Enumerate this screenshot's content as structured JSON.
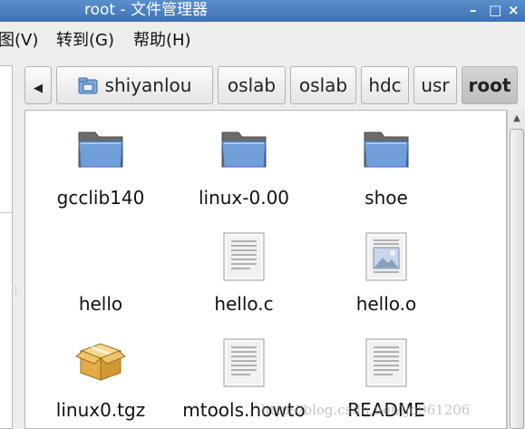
{
  "window": {
    "title": "root - 文件管理器",
    "controls": {
      "minimize": "–",
      "maximize": "□",
      "close": "×"
    }
  },
  "menubar": {
    "items": [
      {
        "label": "图(V)"
      },
      {
        "label": "转到(G)"
      },
      {
        "label": "帮助(H)"
      }
    ]
  },
  "pathbar": {
    "back_arrow": "◀",
    "crumbs": [
      {
        "label": "shiyanlou",
        "icon": "home-folder-icon"
      },
      {
        "label": "oslab"
      },
      {
        "label": "oslab"
      },
      {
        "label": "hdc"
      },
      {
        "label": "usr"
      },
      {
        "label": "root",
        "active": true
      }
    ]
  },
  "files": [
    {
      "name": "gcclib140",
      "icon": "folder-icon"
    },
    {
      "name": "linux-0.00",
      "icon": "folder-icon"
    },
    {
      "name": "shoe",
      "icon": "folder-icon"
    },
    {
      "name": "hello",
      "icon": "none"
    },
    {
      "name": "hello.c",
      "icon": "text-file-icon"
    },
    {
      "name": "hello.o",
      "icon": "image-file-icon"
    },
    {
      "name": "linux0.tgz",
      "icon": "archive-icon"
    },
    {
      "name": "mtools.howto",
      "icon": "text-file-icon"
    },
    {
      "name": "README",
      "icon": "text-file-icon"
    }
  ],
  "scrollbar": {
    "up_arrow": "▲"
  },
  "watermark": "http://blog.csdn.net/ljq961206",
  "colors": {
    "titlebar": "#4a80c2",
    "folder_front": "#6b9ad6",
    "folder_back": "#6f6f6f",
    "archive": "#e3b04e"
  }
}
